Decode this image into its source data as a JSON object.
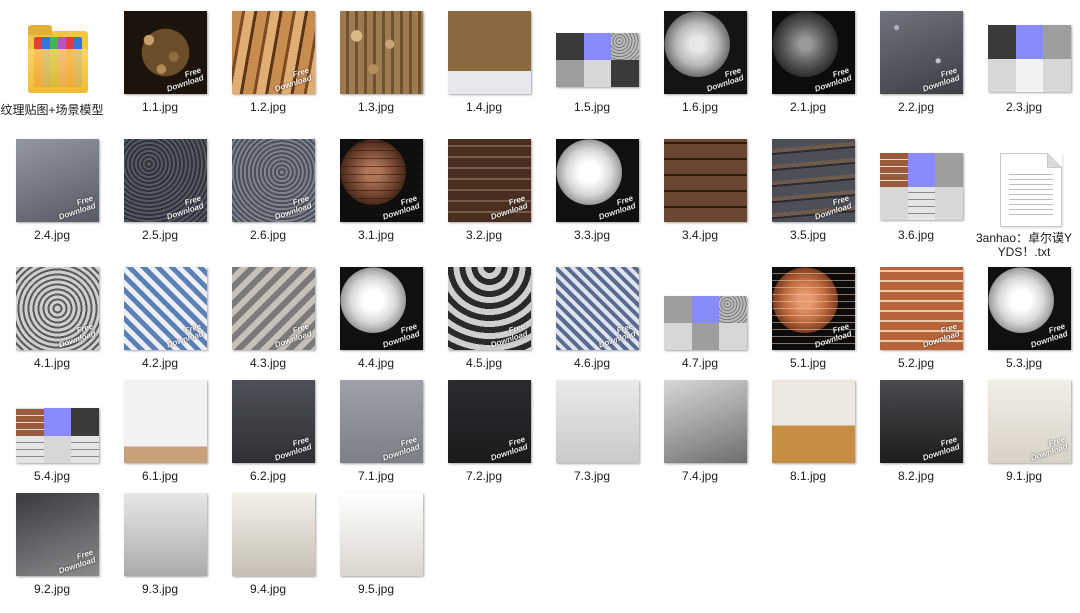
{
  "explorer": {
    "items": [
      {
        "kind": "folder",
        "label": "纹理贴图+场景模型"
      },
      {
        "kind": "image",
        "label": "1.1.jpg",
        "texture": "k-pebble",
        "watermark": true
      },
      {
        "kind": "image",
        "label": "1.2.jpg",
        "texture": "k-wood",
        "watermark": true
      },
      {
        "kind": "image",
        "label": "1.3.jpg",
        "texture": "k-woodpile",
        "watermark": false
      },
      {
        "kind": "image",
        "label": "1.4.jpg",
        "texture": "k-woodsnow",
        "watermark": false
      },
      {
        "kind": "sheet",
        "label": "1.5.jpg",
        "maps": [
          "m-dark",
          "m-normal",
          "m-noise",
          "m-grey",
          "m-light",
          "m-dark"
        ]
      },
      {
        "kind": "image",
        "label": "1.6.jpg",
        "texture": "k-sphere-grey",
        "watermark": true
      },
      {
        "kind": "image",
        "label": "2.1.jpg",
        "texture": "k-sphere-dark",
        "watermark": true
      },
      {
        "kind": "image",
        "label": "2.2.jpg",
        "texture": "k-asphalt",
        "watermark": true
      },
      {
        "kind": "sheet-tall",
        "label": "2.3.jpg",
        "maps": [
          "m-dark",
          "m-normal",
          "m-grey",
          "m-light",
          "m-blank",
          "m-light"
        ]
      },
      {
        "kind": "image",
        "label": "2.4.jpg",
        "texture": "k-asphalt2",
        "watermark": true
      },
      {
        "kind": "image",
        "label": "2.5.jpg",
        "texture": "k-gravel",
        "watermark": true
      },
      {
        "kind": "image",
        "label": "2.6.jpg",
        "texture": "k-gravel2",
        "watermark": true
      },
      {
        "kind": "image",
        "label": "3.1.jpg",
        "texture": "k-sphere-brick",
        "watermark": true
      },
      {
        "kind": "image",
        "label": "3.2.jpg",
        "texture": "k-brickwall",
        "watermark": true
      },
      {
        "kind": "image",
        "label": "3.3.jpg",
        "texture": "k-sphere-white",
        "watermark": true
      },
      {
        "kind": "image",
        "label": "3.4.jpg",
        "texture": "k-stonewall",
        "watermark": false
      },
      {
        "kind": "image",
        "label": "3.5.jpg",
        "texture": "k-stonewall2",
        "watermark": true
      },
      {
        "kind": "sheet-tall",
        "label": "3.6.jpg",
        "maps": [
          "m-brick",
          "m-normal",
          "m-grey",
          "m-light",
          "m-brickwhite",
          "m-light"
        ]
      },
      {
        "kind": "txt",
        "label": "3anhao：卓尔谟YYDS！.txt"
      },
      {
        "kind": "image",
        "label": "4.1.jpg",
        "texture": "k-sphere-pattern",
        "watermark": true
      },
      {
        "kind": "image",
        "label": "4.2.jpg",
        "texture": "k-tile",
        "watermark": true
      },
      {
        "kind": "image",
        "label": "4.3.jpg",
        "texture": "k-tile2",
        "watermark": true
      },
      {
        "kind": "image",
        "label": "4.4.jpg",
        "texture": "k-sphere-white",
        "watermark": true
      },
      {
        "kind": "image",
        "label": "4.5.jpg",
        "texture": "k-wave",
        "watermark": true
      },
      {
        "kind": "image",
        "label": "4.6.jpg",
        "texture": "k-tile3",
        "watermark": true
      },
      {
        "kind": "sheet-mid",
        "label": "4.7.jpg",
        "maps": [
          "m-grey",
          "m-normal",
          "m-noise",
          "m-light",
          "m-grey",
          "m-light"
        ]
      },
      {
        "kind": "image",
        "label": "5.1.jpg",
        "texture": "k-sphere-redbrick",
        "watermark": true
      },
      {
        "kind": "image",
        "label": "5.2.jpg",
        "texture": "k-redbrick",
        "watermark": true
      },
      {
        "kind": "image",
        "label": "5.3.jpg",
        "texture": "k-sphere-white",
        "watermark": true
      },
      {
        "kind": "sheet-low",
        "label": "5.4.jpg",
        "maps": [
          "m-brick",
          "m-normal",
          "m-dark",
          "m-brickwhite",
          "m-light",
          "m-brickwhite"
        ]
      },
      {
        "kind": "image",
        "label": "6.1.jpg",
        "texture": "k-shelf",
        "watermark": false
      },
      {
        "kind": "image",
        "label": "6.2.jpg",
        "texture": "k-shelf-dark",
        "watermark": true
      },
      {
        "kind": "image",
        "label": "7.1.jpg",
        "texture": "k-shelf-grey",
        "watermark": true
      },
      {
        "kind": "image",
        "label": "7.2.jpg",
        "texture": "k-shelf-black",
        "watermark": true
      },
      {
        "kind": "image",
        "label": "7.3.jpg",
        "texture": "k-shelf-light",
        "watermark": false
      },
      {
        "kind": "image",
        "label": "7.4.jpg",
        "texture": "k-shelf-mid",
        "watermark": false
      },
      {
        "kind": "image",
        "label": "8.1.jpg",
        "texture": "k-cups",
        "watermark": false
      },
      {
        "kind": "image",
        "label": "8.2.jpg",
        "texture": "k-cups-dark",
        "watermark": true
      },
      {
        "kind": "image",
        "label": "9.1.jpg",
        "texture": "k-bottles",
        "watermark": true
      },
      {
        "kind": "image",
        "label": "9.2.jpg",
        "texture": "k-bottles-grey",
        "watermark": true
      },
      {
        "kind": "image",
        "label": "9.3.jpg",
        "texture": "k-vase-white",
        "watermark": false
      },
      {
        "kind": "image",
        "label": "9.4.jpg",
        "texture": "k-vase-white2",
        "watermark": false
      },
      {
        "kind": "image",
        "label": "9.5.jpg",
        "texture": "k-vase-white3",
        "watermark": false
      }
    ],
    "watermark_lines": [
      "Free",
      "Download"
    ]
  }
}
